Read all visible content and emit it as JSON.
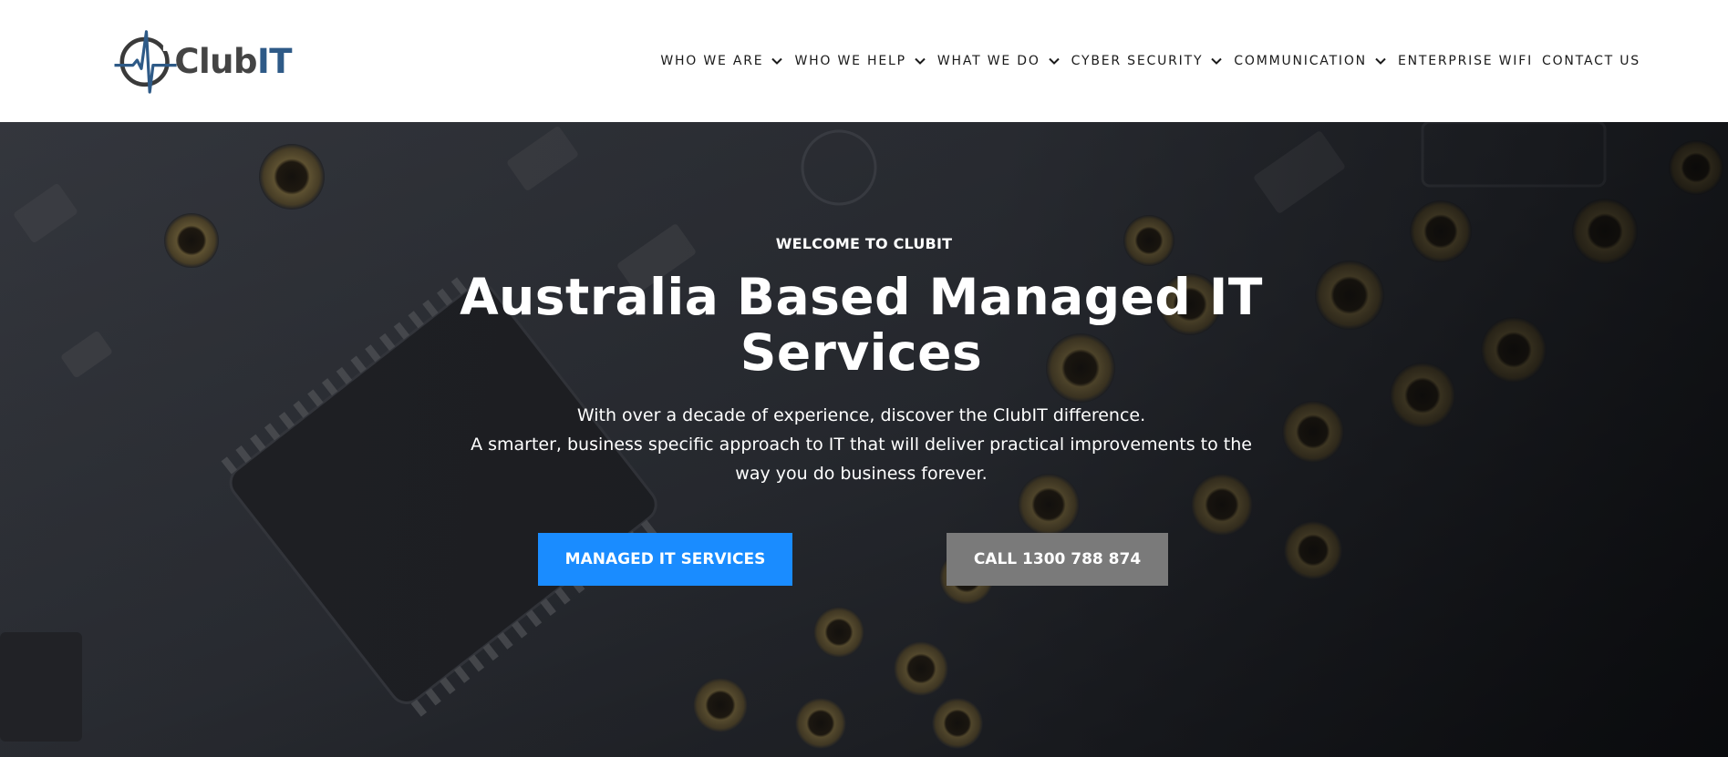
{
  "brand": {
    "name_part1": "Club",
    "name_part2": "IT",
    "primary_color": "#2e5a87",
    "text_color": "#444444"
  },
  "nav": {
    "items": [
      {
        "label": "WHO WE ARE",
        "has_dropdown": true
      },
      {
        "label": "WHO WE HELP",
        "has_dropdown": true
      },
      {
        "label": "WHAT WE DO",
        "has_dropdown": true
      },
      {
        "label": "CYBER SECURITY",
        "has_dropdown": true
      },
      {
        "label": "COMMUNICATION",
        "has_dropdown": true
      },
      {
        "label": "ENTERPRISE WIFI",
        "has_dropdown": false
      },
      {
        "label": "CONTACT US",
        "has_dropdown": false
      }
    ],
    "dropdown_icon": "chevron-down-icon"
  },
  "hero": {
    "eyebrow": "WELCOME TO CLUBIT",
    "headline_line1": "Australia Based Managed IT",
    "headline_line2": "Services",
    "sub_line1": "With over a decade of experience, discover the ClubIT difference.",
    "sub_line2": "A smarter, business specific approach to IT that will deliver practical improvements to the",
    "sub_line3": "way you do business forever.",
    "primary_button": "MANAGED IT SERVICES",
    "secondary_button": "CALL 1300 788 874",
    "primary_color": "#1a8cff",
    "secondary_color": "#7a7a7a",
    "background": "circuit-board-photo"
  }
}
